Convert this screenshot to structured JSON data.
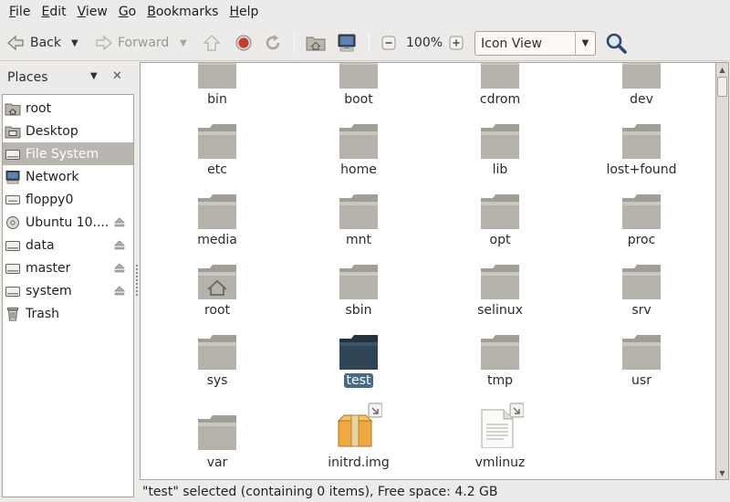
{
  "menubar": {
    "items": [
      {
        "ul": "F",
        "rest": "ile"
      },
      {
        "ul": "E",
        "rest": "dit"
      },
      {
        "ul": "V",
        "rest": "iew"
      },
      {
        "ul": "G",
        "rest": "o"
      },
      {
        "ul": "B",
        "rest": "ookmarks"
      },
      {
        "ul": "H",
        "rest": "elp"
      }
    ]
  },
  "toolbar": {
    "back_label": "Back",
    "forward_label": "Forward",
    "zoom_level": "100%",
    "view_mode": "Icon View"
  },
  "sidebar": {
    "title": "Places",
    "close_glyph": "✕",
    "items": [
      {
        "label": "root",
        "icon": "home-icon"
      },
      {
        "label": "Desktop",
        "icon": "desktop-icon"
      },
      {
        "label": "File System",
        "icon": "drive-icon",
        "selected": true
      },
      {
        "label": "Network",
        "icon": "network-icon"
      },
      {
        "label": "floppy0",
        "icon": "floppy-icon"
      },
      {
        "label": "Ubuntu 10....",
        "icon": "cdrom-icon",
        "eject": true
      },
      {
        "label": "data",
        "icon": "drive-icon",
        "eject": true
      },
      {
        "label": "master",
        "icon": "drive-icon",
        "eject": true
      },
      {
        "label": "system",
        "icon": "drive-icon",
        "eject": true
      },
      {
        "label": "Trash",
        "icon": "trash-icon"
      }
    ]
  },
  "files": [
    {
      "name": "bin"
    },
    {
      "name": "boot"
    },
    {
      "name": "cdrom"
    },
    {
      "name": "dev"
    },
    {
      "name": "etc"
    },
    {
      "name": "home"
    },
    {
      "name": "lib"
    },
    {
      "name": "lost+found"
    },
    {
      "name": "media"
    },
    {
      "name": "mnt"
    },
    {
      "name": "opt"
    },
    {
      "name": "proc"
    },
    {
      "name": "root"
    },
    {
      "name": "sbin"
    },
    {
      "name": "selinux"
    },
    {
      "name": "srv"
    },
    {
      "name": "sys"
    },
    {
      "name": "test"
    },
    {
      "name": "tmp"
    },
    {
      "name": "usr"
    },
    {
      "name": "var"
    },
    {
      "name": "initrd.img"
    },
    {
      "name": "vmlinuz"
    }
  ],
  "status": {
    "text": "\"test\" selected (containing 0 items), Free space: 4.2 GB"
  },
  "colors": {
    "folder": "#b5b2ab",
    "folder_selected": "#2f4455",
    "selection": "#4a6984",
    "sidebar_selected": "#b9b6b1"
  }
}
